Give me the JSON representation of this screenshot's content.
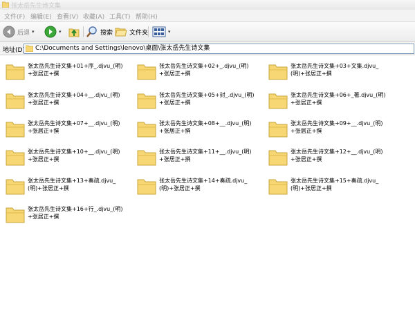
{
  "window": {
    "title": "张太岳先生诗文集",
    "icon": "folder-icon"
  },
  "menubar": {
    "items": [
      "文件(F)",
      "编辑(E)",
      "查看(V)",
      "收藏(A)",
      "工具(T)",
      "帮助(H)"
    ]
  },
  "toolbar": {
    "back_label": "后退",
    "search_label": "搜索",
    "folders_label": "文件夹",
    "icons": {
      "back": "back-arrow-icon",
      "forward": "forward-arrow-icon",
      "up": "folder-up-icon",
      "search": "search-icon",
      "folders": "folders-icon",
      "views": "views-icon"
    }
  },
  "addressbar": {
    "label": "地址(D)",
    "path": "C:\\Documents and Settings\\lenovo\\桌面\\张太岳先生诗文集"
  },
  "items": [
    {
      "name": "张太岳先生诗文集+01+序_.djvu_(明)+张居正+撰"
    },
    {
      "name": "张太岳先生诗文集+02+_.djvu_(明)+张居正+撰"
    },
    {
      "name": "张太岳先生诗文集+03+文集.djvu_(明)+张居正+撰"
    },
    {
      "name": "张太岳先生诗文集+04+__.djvu_(明)+张居正+撰"
    },
    {
      "name": "张太岳先生诗文集+05+封_.djvu_(明)+张居正+撰"
    },
    {
      "name": "张太岳先生诗文集+06+_著.djvu_(明)+张居正+撰"
    },
    {
      "name": "张太岳先生诗文集+07+__.djvu_(明)+张居正+撰"
    },
    {
      "name": "张太岳先生诗文集+08+__.djvu_(明)+张居正+撰"
    },
    {
      "name": "张太岳先生诗文集+09+__.djvu_(明)+张居正+撰"
    },
    {
      "name": "张太岳先生诗文集+10+__.djvu_(明)+张居正+撰"
    },
    {
      "name": "张太岳先生诗文集+11+__.djvu_(明)+张居正+撰"
    },
    {
      "name": "张太岳先生诗文集+12+__.djvu_(明)+张居正+撰"
    },
    {
      "name": "张太岳先生诗文集+13+奏疏.djvu_(明)+张居正+撰"
    },
    {
      "name": "张太岳先生诗文集+14+奏疏.djvu_(明)+张居正+撰"
    },
    {
      "name": "张太岳先生诗文集+15+奏疏.djvu_(明)+张居正+撰"
    },
    {
      "name": "张太岳先生诗文集+16+行_.djvu_(明)+张居正+撰"
    }
  ],
  "colors": {
    "folder_fill": "#f7d774",
    "folder_edge": "#c9a43a",
    "address_border": "#7f9db9"
  }
}
